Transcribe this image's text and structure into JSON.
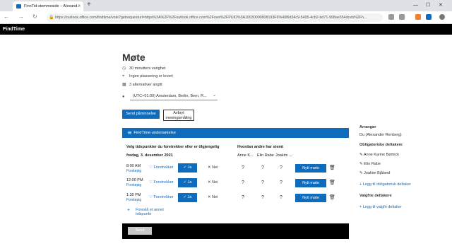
{
  "browser": {
    "tab_title": "FinnTid-stemmeside – Alexand...",
    "tab_close": "×",
    "new_tab": "+",
    "url": "https://outlook.office.com/findtime/vote?getrequesturl=https%3A%2F%2Foutlook.office.com%2Fows%2FPUID%3A10030000808193F6%40f6d34c9-5405-4cb2-bd71-908ae354dceb%2Fh...",
    "window_min": "—",
    "window_max": "☐",
    "window_close": "✕"
  },
  "app": {
    "title": "FindTime"
  },
  "meeting": {
    "title": "Møte",
    "duration": "30 minutters varighet",
    "location": "Ingen plassering er levert",
    "alternatives": "3 alternativer angitt",
    "timezone": "(UTC+01:00) Amsterdam, Berlin, Bern, R..."
  },
  "actions": {
    "send_reminder": "Send påminnelse",
    "cancel_poll_line1": "Avbryt",
    "cancel_poll_line2": "meningsmåling"
  },
  "panel": {
    "header": "FindTime-undersøkelse",
    "instruction": "Velg tidspunkter du foretrekker eller er tilgjengelig",
    "others_voted": "Hvordan andre har stemt",
    "date": "fredag, 3. desember 2021",
    "participants": [
      "Anne K...",
      "Elin Rabe",
      "Joakim ..."
    ],
    "slots": [
      {
        "time": "8:00 AM",
        "status": "Foreløpig",
        "prefer": "Foretrekker",
        "yes": "Ja",
        "no": "Nei",
        "votes": [
          "?",
          "?",
          "?"
        ],
        "new_meeting": "Nytt møte"
      },
      {
        "time": "12:00 PM",
        "status": "Foreløpig",
        "prefer": "Foretrekker",
        "yes": "Ja",
        "no": "Nei",
        "votes": [
          "?",
          "?",
          "?"
        ],
        "new_meeting": "Nytt møte"
      },
      {
        "time": "1:30 PM",
        "status": "Foreløpig",
        "prefer": "Foretrekker",
        "yes": "Ja",
        "no": "Nei",
        "votes": [
          "?",
          "?",
          "?"
        ],
        "new_meeting": "Nytt møte"
      }
    ],
    "suggest_time": "Foreslå et annet tidspunkt",
    "send": "Send"
  },
  "sidebar": {
    "organizer_heading": "Arrangør",
    "organizer": "Du (Alexander Renberg)",
    "required_heading": "Obligatoriske deltakere",
    "required": [
      "Anne Karine Bømick",
      "Elin Rabe",
      "Joakim Bjåland"
    ],
    "add_required": "Legg til obligatorisk deltaker",
    "optional_heading": "Valgfrie deltakere",
    "add_optional": "Legg til valgfri deltaker"
  }
}
